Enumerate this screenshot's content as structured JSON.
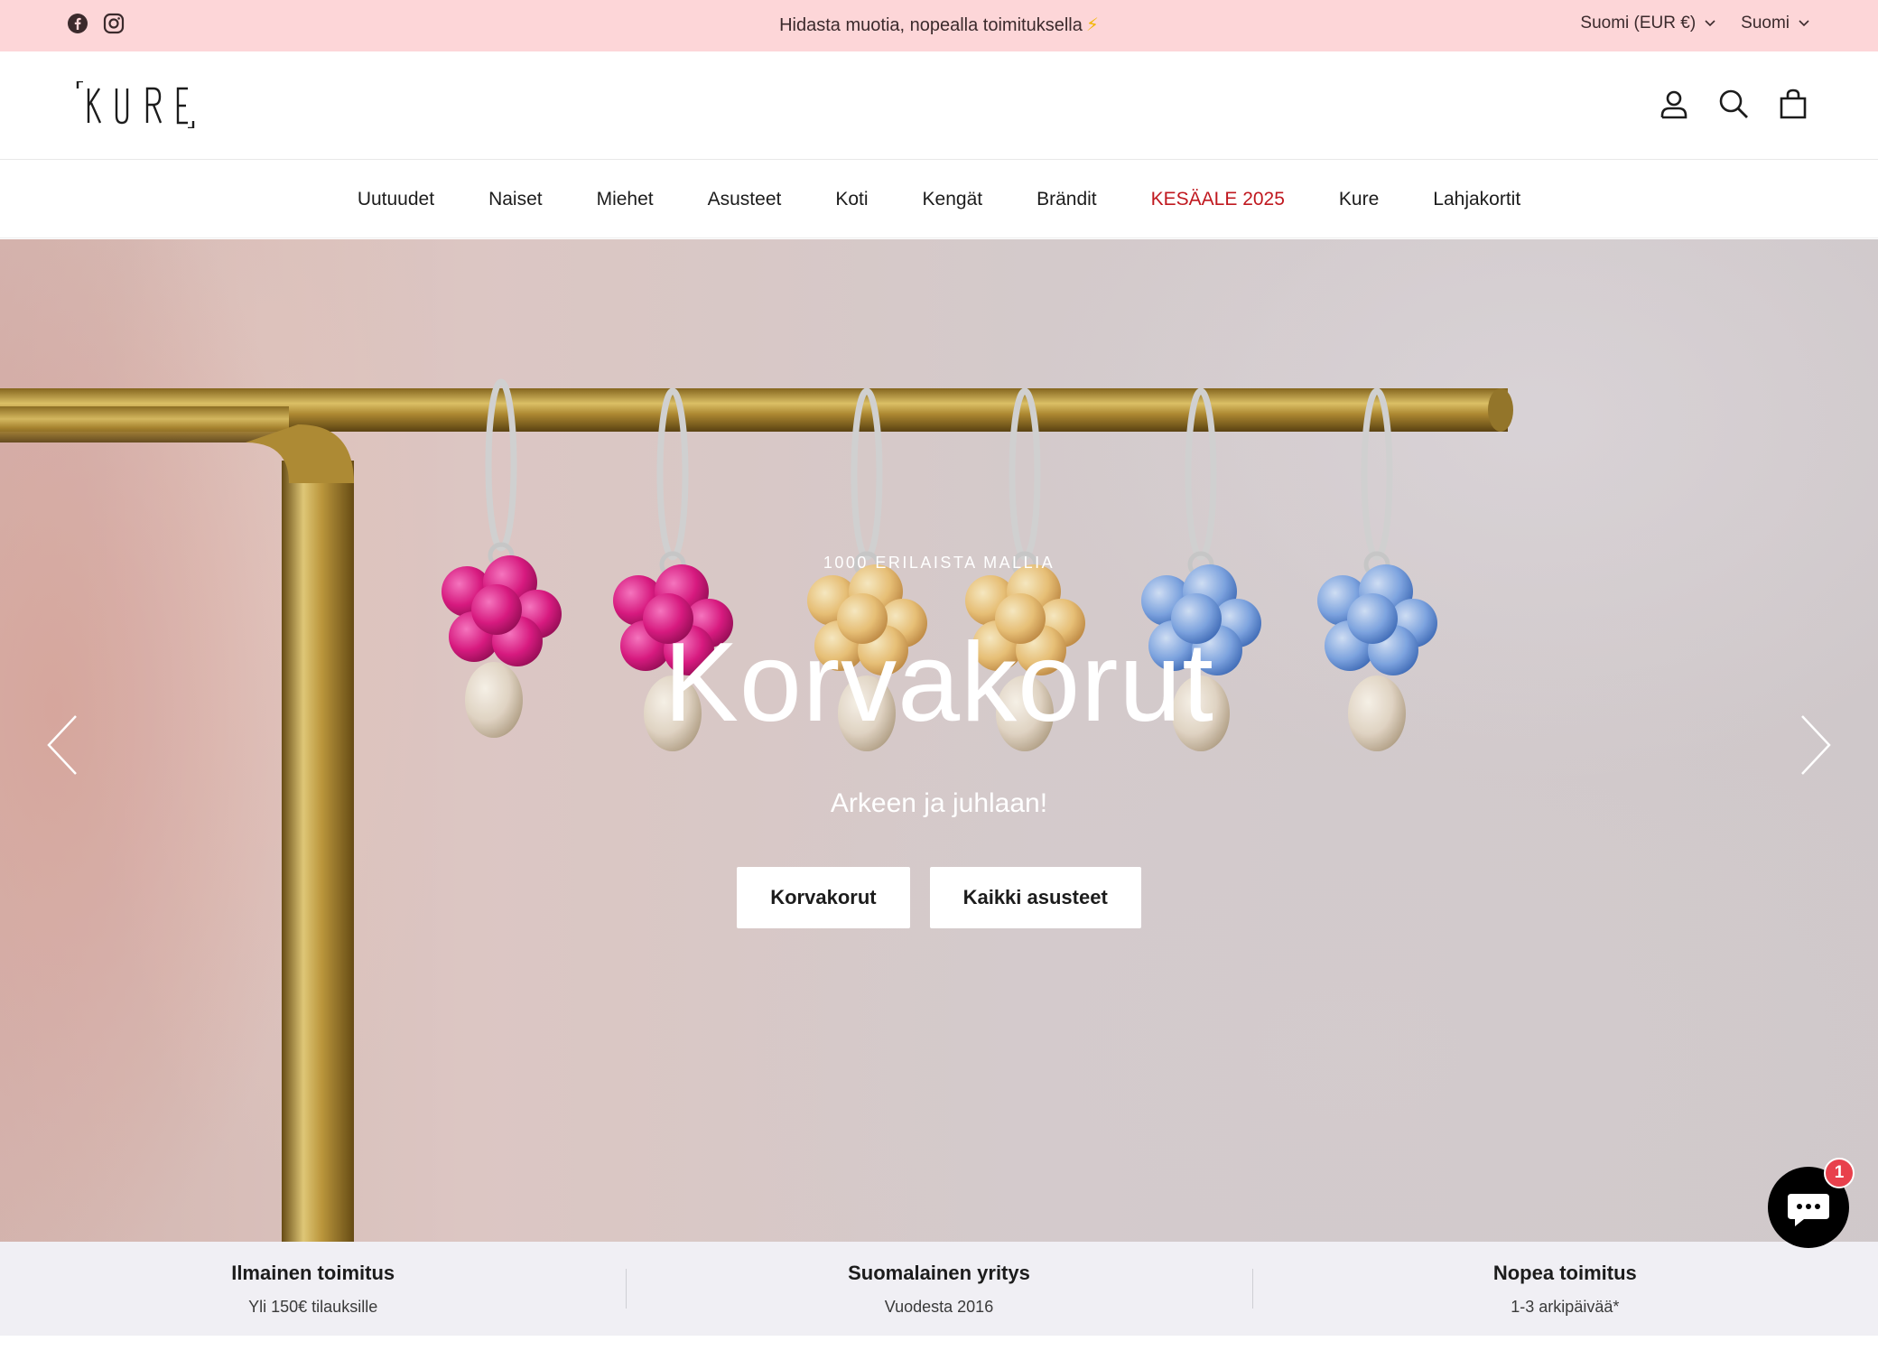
{
  "topbar": {
    "announcement": "Hidasta muotia, nopealla toimituksella",
    "announcement_emoji": "⚡",
    "currency_selector": "Suomi (EUR €)",
    "language_selector": "Suomi",
    "social_icons": [
      "facebook-icon",
      "instagram-icon"
    ]
  },
  "header": {
    "logo_text": "KURE",
    "icons": [
      "account-icon",
      "search-icon",
      "cart-icon"
    ]
  },
  "nav": {
    "items": [
      {
        "label": "Uutuudet"
      },
      {
        "label": "Naiset"
      },
      {
        "label": "Miehet"
      },
      {
        "label": "Asusteet"
      },
      {
        "label": "Koti"
      },
      {
        "label": "Kengät"
      },
      {
        "label": "Brändit"
      },
      {
        "label": "KESÄALE 2025",
        "color": "#c0181f"
      },
      {
        "label": "Kure"
      },
      {
        "label": "Lahjakortit"
      }
    ]
  },
  "hero": {
    "eyebrow": "1000 ERILAISTA MALLIA",
    "headline": "Korvakorut",
    "subheading": "Arkeen ja juhlaan!",
    "buttons": [
      {
        "label": "Korvakorut"
      },
      {
        "label": "Kaikki asusteet"
      }
    ]
  },
  "features": [
    {
      "title": "Ilmainen toimitus",
      "subtitle": "Yli 150€ tilauksille"
    },
    {
      "title": "Suomalainen yritys",
      "subtitle": "Vuodesta 2016"
    },
    {
      "title": "Nopea toimitus",
      "subtitle": "1-3 arkipäivää*"
    }
  ],
  "chat": {
    "badge_count": "1"
  },
  "colors": {
    "topbar_bg": "#fdd6d8",
    "sale": "#c0181f",
    "features_bg": "#f0eff4",
    "chat_badge": "#e8404c"
  }
}
